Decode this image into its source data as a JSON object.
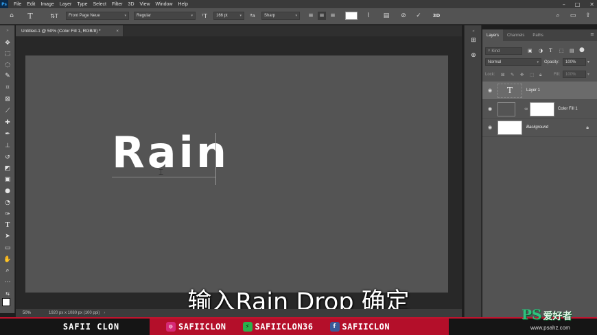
{
  "app": {
    "logo": "Ps",
    "menu": [
      "File",
      "Edit",
      "Image",
      "Layer",
      "Type",
      "Select",
      "Filter",
      "3D",
      "View",
      "Window",
      "Help"
    ],
    "window_controls": [
      "–",
      "□",
      "✕"
    ]
  },
  "options_bar": {
    "font_family": "Front Page Neue",
    "font_style": "Regular",
    "font_size": "166 pt",
    "antialias": "Sharp",
    "text_color": "#ffffff"
  },
  "document": {
    "tab_title": "Untitled-1 @ 50% (Color Fill 1, RGB/8) *",
    "tab_close": "×",
    "canvas_text": "Rain"
  },
  "status": {
    "zoom": "50%",
    "dimensions": "1920 px x 1080 px (100 ppi)",
    "arrow": "›"
  },
  "subtitle": "输入Rain Drop 确定",
  "layers_panel": {
    "tabs": [
      "Layers",
      "Channels",
      "Paths"
    ],
    "active_tab": "Layers",
    "kind_placeholder": "Kind",
    "blend_mode": "Normal",
    "opacity_label": "Opacity:",
    "opacity_value": "100%",
    "lock_label": "Lock:",
    "fill_label": "Fill:",
    "fill_value": "100%",
    "layers": [
      {
        "name": "Layer 1",
        "type": "text",
        "thumb_glyph": "T",
        "selected": true
      },
      {
        "name": "Color Fill 1",
        "type": "fill",
        "selected": false
      },
      {
        "name": "Background",
        "type": "background",
        "selected": false
      }
    ]
  },
  "banner": {
    "left": "SAFII CLON",
    "instagram": "SAFIICLON",
    "gamejolt": "SAFIICLON36",
    "facebook": "SAFIICLON"
  },
  "watermark": {
    "brand": "PS",
    "brand_cn": "爱好者",
    "url": "www.psahz.com"
  },
  "colors": {
    "accent": "#b40f2a",
    "canvas": "#545454",
    "text": "#ffffff"
  }
}
